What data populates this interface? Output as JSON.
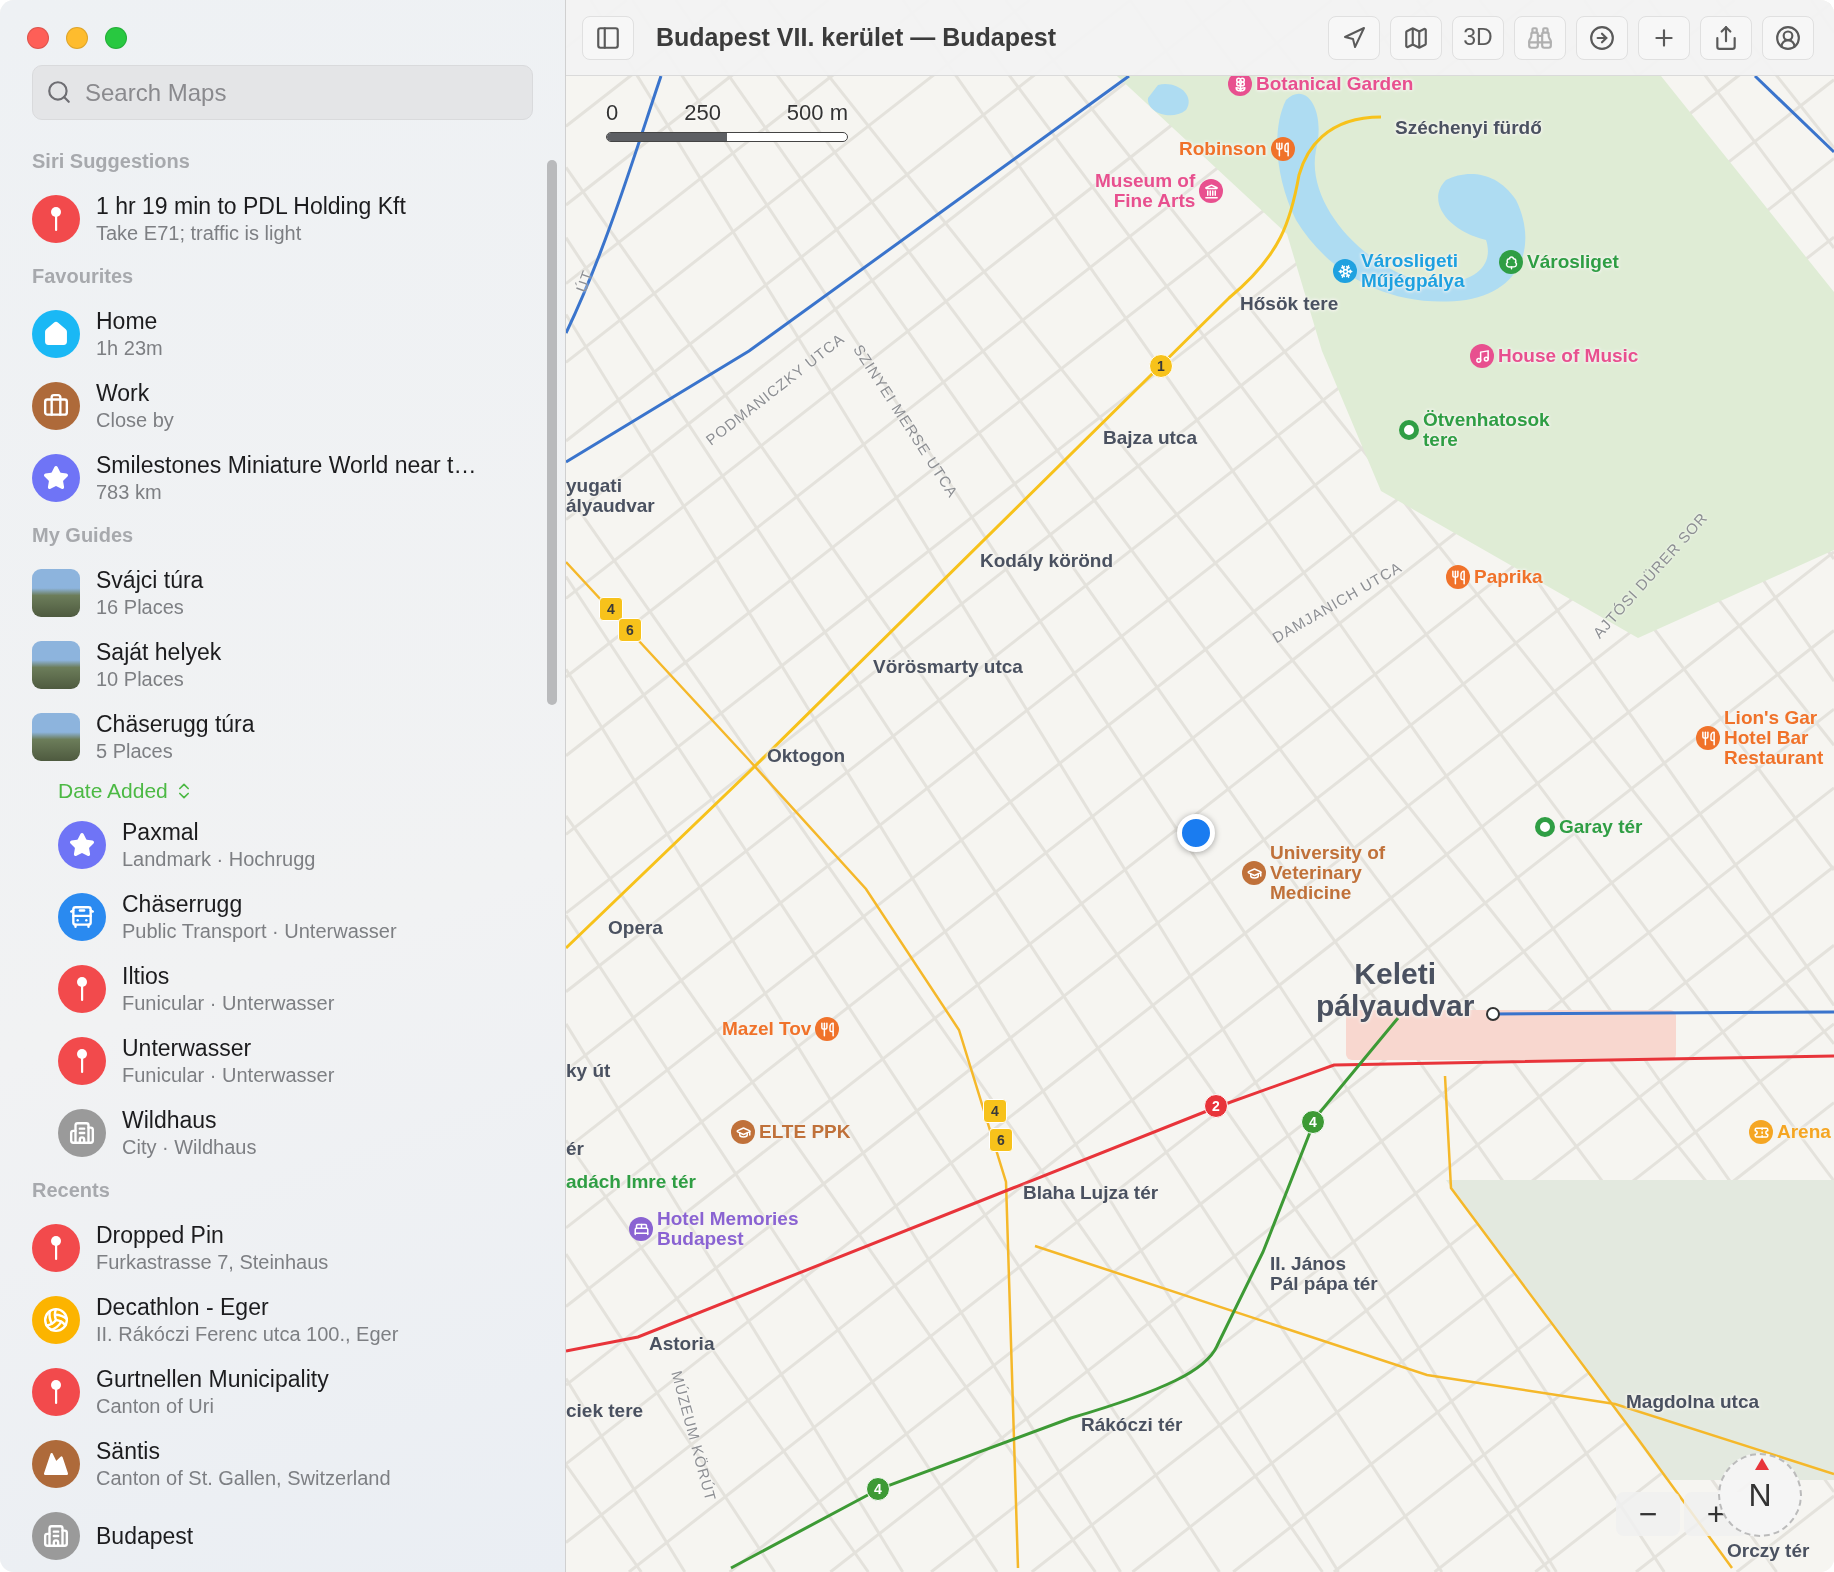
{
  "window": {
    "title": "Budapest VII. kerület — Budapest"
  },
  "toolbar": {
    "view_button": "3D"
  },
  "search": {
    "placeholder": "Search Maps"
  },
  "sections": [
    {
      "heading": "Siri Suggestions",
      "items": [
        {
          "kind": "pin",
          "color": "#f24a4c",
          "title": "1 hr 19 min to PDL Holding Kft",
          "subtitle": "Take E71; traffic is light"
        }
      ]
    },
    {
      "heading": "Favourites",
      "items": [
        {
          "kind": "home",
          "color": "#1ab8f5",
          "title": "Home",
          "subtitle": "1h 23m"
        },
        {
          "kind": "briefcase",
          "color": "#ae6a3a",
          "title": "Work",
          "subtitle": "Close by"
        },
        {
          "kind": "star",
          "color": "#6f74f6",
          "title": "Smilestones Miniature World near t…",
          "subtitle": "783 km"
        }
      ]
    },
    {
      "heading": "My Guides",
      "items": [
        {
          "kind": "photo",
          "title": "Svájci túra",
          "subtitle": "16 Places"
        },
        {
          "kind": "photo",
          "title": "Saját helyek",
          "subtitle": "10 Places"
        },
        {
          "kind": "photo",
          "title": "Chäserugg túra",
          "subtitle": "5 Places",
          "sort_label": "Date Added",
          "children": [
            {
              "kind": "star",
              "color": "#6f74f6",
              "title": "Paxmal",
              "subtitle": "Landmark · Hochrugg"
            },
            {
              "kind": "bus",
              "color": "#2a8af0",
              "title": "Chäserrugg",
              "subtitle": "Public Transport · Unterwasser"
            },
            {
              "kind": "pin",
              "color": "#f24a4c",
              "title": "Iltios",
              "subtitle": "Funicular · Unterwasser"
            },
            {
              "kind": "pin",
              "color": "#f24a4c",
              "title": "Unterwasser",
              "subtitle": "Funicular · Unterwasser"
            },
            {
              "kind": "city",
              "color": "#9a9a9a",
              "title": "Wildhaus",
              "subtitle": "City · Wildhaus"
            }
          ]
        }
      ]
    },
    {
      "heading": "Recents",
      "items": [
        {
          "kind": "pin",
          "color": "#f24a4c",
          "title": "Dropped Pin",
          "subtitle": "Furkastrasse 7, Steinhaus"
        },
        {
          "kind": "sports",
          "color": "#fcb400",
          "title": "Decathlon - Eger",
          "subtitle": "II. Rákóczi Ferenc utca 100., Eger"
        },
        {
          "kind": "pin",
          "color": "#f24a4c",
          "title": "Gurtnellen Municipality",
          "subtitle": "Canton of Uri"
        },
        {
          "kind": "mountain",
          "color": "#ae6a3a",
          "title": "Säntis",
          "subtitle": "Canton of St. Gallen, Switzerland"
        },
        {
          "kind": "city",
          "color": "#9a9a9a",
          "title": "Budapest"
        }
      ]
    }
  ],
  "map": {
    "scale": {
      "ticks": [
        "0",
        "250",
        "500 m"
      ],
      "level": 0.5
    },
    "places": [
      {
        "name": "Botanical Garden",
        "kind": "garden",
        "color": "#e8508f"
      },
      {
        "name": "Széchenyi fürdő",
        "kind": "label",
        "color": "#4a5160"
      },
      {
        "name": "Robinson",
        "kind": "restaurant",
        "color": "#f0722a"
      },
      {
        "name": "Museum of\nFine Arts",
        "kind": "museum",
        "color": "#e8508f"
      },
      {
        "name": "Városligeti\nMűjégpálya",
        "kind": "skating",
        "color": "#1ea1e0"
      },
      {
        "name": "Városliget",
        "kind": "park",
        "color": "#2f9e44"
      },
      {
        "name": "Hősök tere",
        "kind": "label",
        "color": "#4a5160"
      },
      {
        "name": "House of Music",
        "kind": "music",
        "color": "#e8508f"
      },
      {
        "name": "Bajza utca",
        "kind": "label",
        "color": "#4a5160"
      },
      {
        "name": "Ötvenhatosok\ntere",
        "kind": "stop",
        "color": "#2f9e44"
      },
      {
        "name": "yugati\nályaudvar",
        "kind": "label",
        "color": "#4a5160"
      },
      {
        "name": "Kodály körönd",
        "kind": "label",
        "color": "#4a5160"
      },
      {
        "name": "Paprika",
        "kind": "restaurant",
        "color": "#f0722a"
      },
      {
        "name": "Vörösmarty utca",
        "kind": "label",
        "color": "#4a5160"
      },
      {
        "name": "Oktogon",
        "kind": "label",
        "color": "#4a5160"
      },
      {
        "name": "Lion's Gar\nHotel Bar\nRestaurant",
        "kind": "restaurant",
        "color": "#f0722a"
      },
      {
        "name": "Garay tér",
        "kind": "stop",
        "color": "#2f9e44"
      },
      {
        "name": "University of\nVeterinary\nMedicine",
        "kind": "university",
        "color": "#c0713a"
      },
      {
        "name": "Opera",
        "kind": "label",
        "color": "#4a5160"
      },
      {
        "name": "Keleti\npályaudvar",
        "kind": "station",
        "color": "#4a5160"
      },
      {
        "name": "Mazel Tov",
        "kind": "restaurant",
        "color": "#f0722a"
      },
      {
        "name": "ky út",
        "kind": "label",
        "color": "#4a5160"
      },
      {
        "name": "ELTE PPK",
        "kind": "university",
        "color": "#c0713a"
      },
      {
        "name": "ér",
        "kind": "label",
        "color": "#4a5160"
      },
      {
        "name": "adách Imre tér",
        "kind": "label",
        "color": "#2f9e44"
      },
      {
        "name": "Arena",
        "kind": "venue",
        "color": "#f5a623"
      },
      {
        "name": "Hotel Memories\nBudapest",
        "kind": "hotel",
        "color": "#8a63d2"
      },
      {
        "name": "Blaha Lujza tér",
        "kind": "label",
        "color": "#4a5160"
      },
      {
        "name": "II. János\nPál pápa tér",
        "kind": "label",
        "color": "#4a5160"
      },
      {
        "name": "Astoria",
        "kind": "label",
        "color": "#4a5160"
      },
      {
        "name": "ciek tere",
        "kind": "label",
        "color": "#4a5160"
      },
      {
        "name": "Rákóczi tér",
        "kind": "label",
        "color": "#4a5160"
      },
      {
        "name": "Magdolna utca",
        "kind": "label",
        "color": "#4a5160"
      },
      {
        "name": "Orczy tér",
        "kind": "label",
        "color": "#4a5160"
      }
    ],
    "streets": [
      "PODMANICZKY UTCA",
      "SZINYEI MERSE UTCA",
      "DAMJANICH UTCA",
      "AJTÓSI DÜRER SOR",
      "MÚZEUM KÖRÚT",
      "ÚT"
    ],
    "transit_badges": [
      {
        "label": "4",
        "kind": "tram",
        "color": "#f7c21b"
      },
      {
        "label": "6",
        "kind": "tram",
        "color": "#f7c21b"
      },
      {
        "label": "4",
        "kind": "tram",
        "color": "#f7c21b"
      },
      {
        "label": "6",
        "kind": "tram",
        "color": "#f7c21b"
      },
      {
        "label": "1",
        "kind": "metro",
        "color": "#f7c21b"
      },
      {
        "label": "2",
        "kind": "metro",
        "color": "#e8343a"
      },
      {
        "label": "4",
        "kind": "metro",
        "color": "#3d9a35"
      },
      {
        "label": "4",
        "kind": "metro",
        "color": "#3d9a35"
      }
    ],
    "compass": "N",
    "zoom_buttons": [
      "−",
      "+"
    ]
  }
}
